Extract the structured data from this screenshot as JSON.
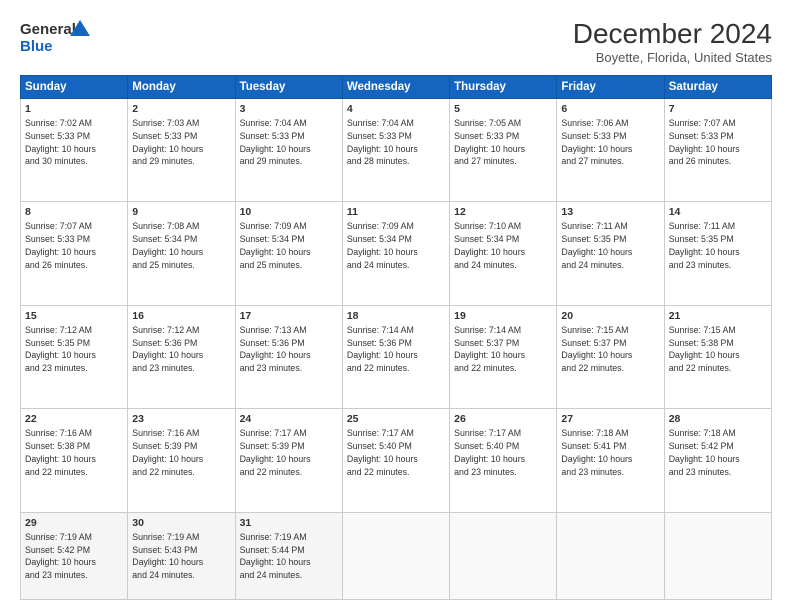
{
  "logo": {
    "line1": "General",
    "line2": "Blue"
  },
  "title": "December 2024",
  "subtitle": "Boyette, Florida, United States",
  "days_of_week": [
    "Sunday",
    "Monday",
    "Tuesday",
    "Wednesday",
    "Thursday",
    "Friday",
    "Saturday"
  ],
  "weeks": [
    [
      {
        "day": "1",
        "info": "Sunrise: 7:02 AM\nSunset: 5:33 PM\nDaylight: 10 hours\nand 30 minutes."
      },
      {
        "day": "2",
        "info": "Sunrise: 7:03 AM\nSunset: 5:33 PM\nDaylight: 10 hours\nand 29 minutes."
      },
      {
        "day": "3",
        "info": "Sunrise: 7:04 AM\nSunset: 5:33 PM\nDaylight: 10 hours\nand 29 minutes."
      },
      {
        "day": "4",
        "info": "Sunrise: 7:04 AM\nSunset: 5:33 PM\nDaylight: 10 hours\nand 28 minutes."
      },
      {
        "day": "5",
        "info": "Sunrise: 7:05 AM\nSunset: 5:33 PM\nDaylight: 10 hours\nand 27 minutes."
      },
      {
        "day": "6",
        "info": "Sunrise: 7:06 AM\nSunset: 5:33 PM\nDaylight: 10 hours\nand 27 minutes."
      },
      {
        "day": "7",
        "info": "Sunrise: 7:07 AM\nSunset: 5:33 PM\nDaylight: 10 hours\nand 26 minutes."
      }
    ],
    [
      {
        "day": "8",
        "info": "Sunrise: 7:07 AM\nSunset: 5:33 PM\nDaylight: 10 hours\nand 26 minutes."
      },
      {
        "day": "9",
        "info": "Sunrise: 7:08 AM\nSunset: 5:34 PM\nDaylight: 10 hours\nand 25 minutes."
      },
      {
        "day": "10",
        "info": "Sunrise: 7:09 AM\nSunset: 5:34 PM\nDaylight: 10 hours\nand 25 minutes."
      },
      {
        "day": "11",
        "info": "Sunrise: 7:09 AM\nSunset: 5:34 PM\nDaylight: 10 hours\nand 24 minutes."
      },
      {
        "day": "12",
        "info": "Sunrise: 7:10 AM\nSunset: 5:34 PM\nDaylight: 10 hours\nand 24 minutes."
      },
      {
        "day": "13",
        "info": "Sunrise: 7:11 AM\nSunset: 5:35 PM\nDaylight: 10 hours\nand 24 minutes."
      },
      {
        "day": "14",
        "info": "Sunrise: 7:11 AM\nSunset: 5:35 PM\nDaylight: 10 hours\nand 23 minutes."
      }
    ],
    [
      {
        "day": "15",
        "info": "Sunrise: 7:12 AM\nSunset: 5:35 PM\nDaylight: 10 hours\nand 23 minutes."
      },
      {
        "day": "16",
        "info": "Sunrise: 7:12 AM\nSunset: 5:36 PM\nDaylight: 10 hours\nand 23 minutes."
      },
      {
        "day": "17",
        "info": "Sunrise: 7:13 AM\nSunset: 5:36 PM\nDaylight: 10 hours\nand 23 minutes."
      },
      {
        "day": "18",
        "info": "Sunrise: 7:14 AM\nSunset: 5:36 PM\nDaylight: 10 hours\nand 22 minutes."
      },
      {
        "day": "19",
        "info": "Sunrise: 7:14 AM\nSunset: 5:37 PM\nDaylight: 10 hours\nand 22 minutes."
      },
      {
        "day": "20",
        "info": "Sunrise: 7:15 AM\nSunset: 5:37 PM\nDaylight: 10 hours\nand 22 minutes."
      },
      {
        "day": "21",
        "info": "Sunrise: 7:15 AM\nSunset: 5:38 PM\nDaylight: 10 hours\nand 22 minutes."
      }
    ],
    [
      {
        "day": "22",
        "info": "Sunrise: 7:16 AM\nSunset: 5:38 PM\nDaylight: 10 hours\nand 22 minutes."
      },
      {
        "day": "23",
        "info": "Sunrise: 7:16 AM\nSunset: 5:39 PM\nDaylight: 10 hours\nand 22 minutes."
      },
      {
        "day": "24",
        "info": "Sunrise: 7:17 AM\nSunset: 5:39 PM\nDaylight: 10 hours\nand 22 minutes."
      },
      {
        "day": "25",
        "info": "Sunrise: 7:17 AM\nSunset: 5:40 PM\nDaylight: 10 hours\nand 22 minutes."
      },
      {
        "day": "26",
        "info": "Sunrise: 7:17 AM\nSunset: 5:40 PM\nDaylight: 10 hours\nand 23 minutes."
      },
      {
        "day": "27",
        "info": "Sunrise: 7:18 AM\nSunset: 5:41 PM\nDaylight: 10 hours\nand 23 minutes."
      },
      {
        "day": "28",
        "info": "Sunrise: 7:18 AM\nSunset: 5:42 PM\nDaylight: 10 hours\nand 23 minutes."
      }
    ],
    [
      {
        "day": "29",
        "info": "Sunrise: 7:19 AM\nSunset: 5:42 PM\nDaylight: 10 hours\nand 23 minutes."
      },
      {
        "day": "30",
        "info": "Sunrise: 7:19 AM\nSunset: 5:43 PM\nDaylight: 10 hours\nand 24 minutes."
      },
      {
        "day": "31",
        "info": "Sunrise: 7:19 AM\nSunset: 5:44 PM\nDaylight: 10 hours\nand 24 minutes."
      },
      {
        "day": "",
        "info": ""
      },
      {
        "day": "",
        "info": ""
      },
      {
        "day": "",
        "info": ""
      },
      {
        "day": "",
        "info": ""
      }
    ]
  ]
}
